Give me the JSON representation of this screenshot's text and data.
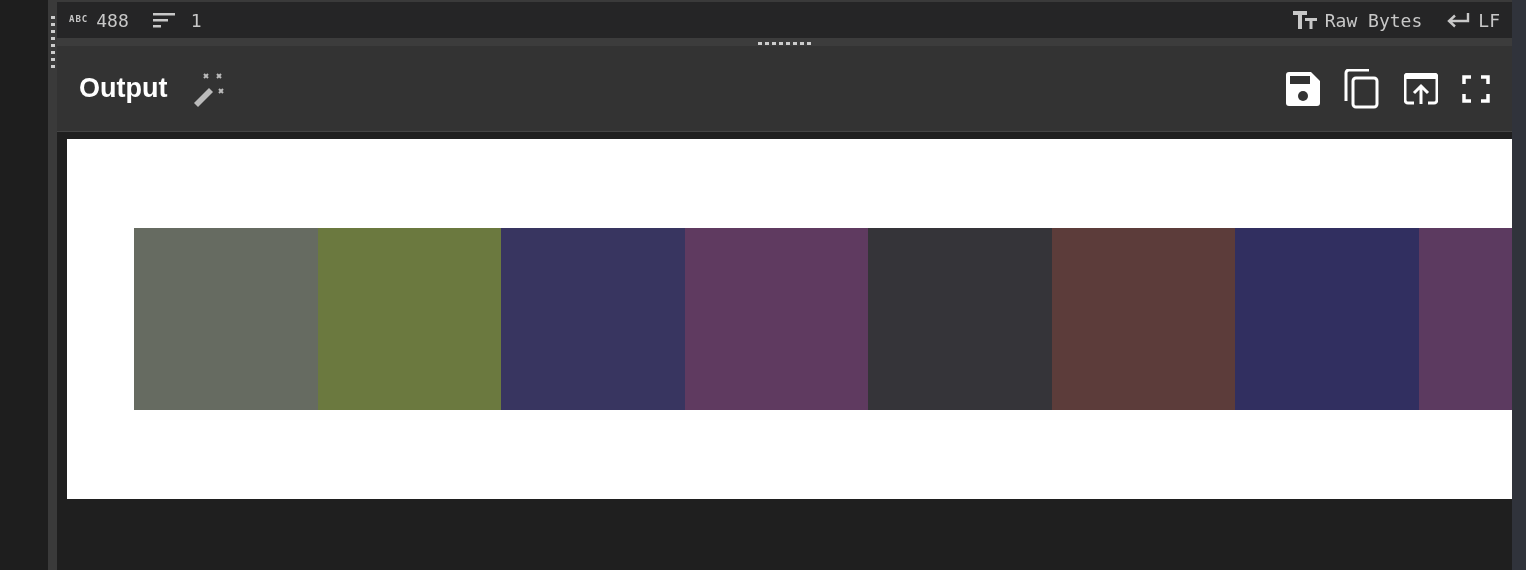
{
  "status_bar": {
    "chars_label": "ABC",
    "chars": "488",
    "lines": "1",
    "encoding": "Raw Bytes",
    "line_ending": "LF"
  },
  "output": {
    "title": "Output",
    "swatches": [
      {
        "color": "#666b61"
      },
      {
        "color": "#6b793f"
      },
      {
        "color": "#383560"
      },
      {
        "color": "#5f3a60"
      },
      {
        "color": "#353439"
      },
      {
        "color": "#5c3c3a"
      },
      {
        "color": "#312f60"
      },
      {
        "color": "#5c3a60"
      }
    ]
  }
}
